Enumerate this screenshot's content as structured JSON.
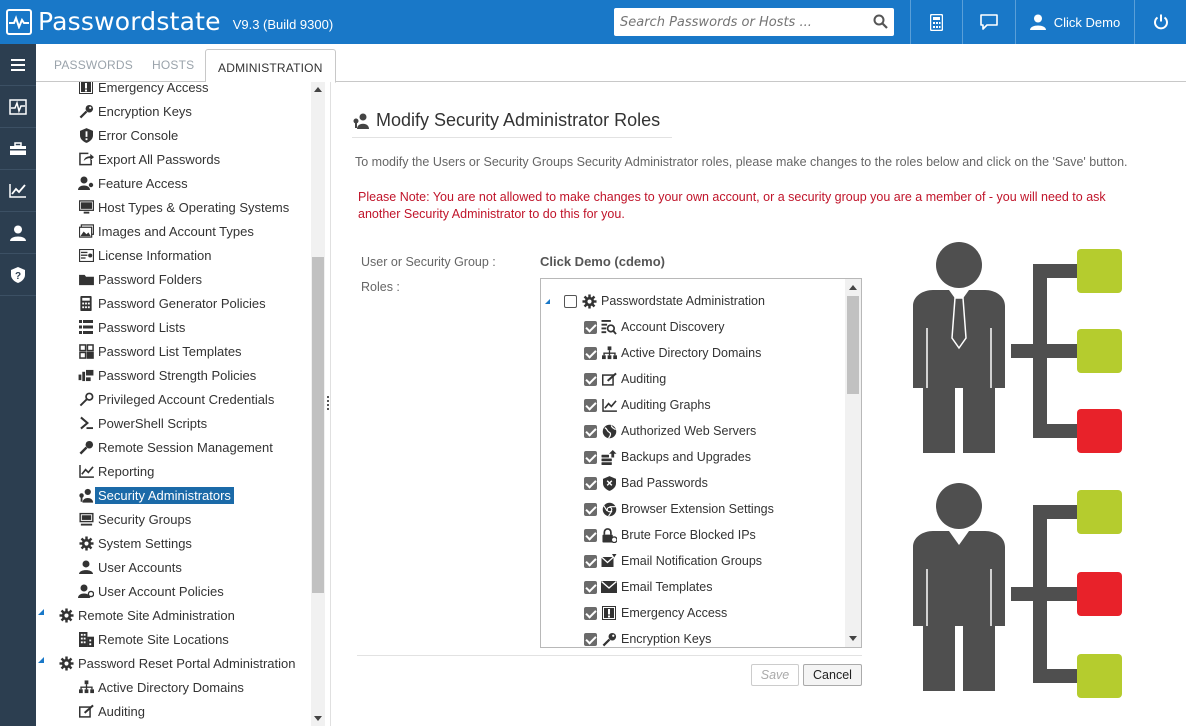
{
  "header": {
    "app_name": "Passwordstate",
    "version": "V9.3 (Build 9300)",
    "search_placeholder": "Search Passwords or Hosts ...",
    "user_name": "Click Demo",
    "bg_color": "#1978c8"
  },
  "rail_icons": [
    "menu-icon",
    "activity-icon",
    "toolbox-icon",
    "chart-icon",
    "user-admin-icon",
    "shield-icon"
  ],
  "tabs": [
    {
      "label": "PASSWORDS",
      "active": false
    },
    {
      "label": "HOSTS",
      "active": false
    },
    {
      "label": "ADMINISTRATION",
      "active": true
    }
  ],
  "tree": [
    {
      "label": "Emergency Access",
      "icon": "emergency-icon",
      "level": 2
    },
    {
      "label": "Encryption Keys",
      "icon": "key-icon",
      "level": 2
    },
    {
      "label": "Error Console",
      "icon": "shield-exclaim-icon",
      "level": 2
    },
    {
      "label": "Export All Passwords",
      "icon": "export-icon",
      "level": 2
    },
    {
      "label": "Feature Access",
      "icon": "user-key-icon",
      "level": 2
    },
    {
      "label": "Host Types & Operating Systems",
      "icon": "monitor-icon",
      "level": 2
    },
    {
      "label": "Images and Account Types",
      "icon": "images-icon",
      "level": 2
    },
    {
      "label": "License Information",
      "icon": "license-icon",
      "level": 2
    },
    {
      "label": "Password Folders",
      "icon": "folder-icon",
      "level": 2
    },
    {
      "label": "Password Generator Policies",
      "icon": "calculator-icon",
      "level": 2
    },
    {
      "label": "Password Lists",
      "icon": "list-icon",
      "level": 2
    },
    {
      "label": "Password List Templates",
      "icon": "templates-icon",
      "level": 2
    },
    {
      "label": "Password Strength Policies",
      "icon": "strength-icon",
      "level": 2
    },
    {
      "label": "Privileged Account Credentials",
      "icon": "privileged-key-icon",
      "level": 2
    },
    {
      "label": "PowerShell Scripts",
      "icon": "powershell-icon",
      "level": 2
    },
    {
      "label": "Remote Session Management",
      "icon": "remote-session-icon",
      "level": 2
    },
    {
      "label": "Reporting",
      "icon": "reporting-icon",
      "level": 2
    },
    {
      "label": "Security Administrators",
      "icon": "security-admins-icon",
      "level": 2,
      "selected": true
    },
    {
      "label": "Security Groups",
      "icon": "security-groups-icon",
      "level": 2
    },
    {
      "label": "System Settings",
      "icon": "gear-icon",
      "level": 2
    },
    {
      "label": "User Accounts",
      "icon": "user-icon",
      "level": 2
    },
    {
      "label": "User Account Policies",
      "icon": "user-policy-icon",
      "level": 2
    },
    {
      "label": "Remote Site Administration",
      "icon": "gear-icon",
      "level": 1,
      "expanded": true
    },
    {
      "label": "Remote Site Locations",
      "icon": "building-icon",
      "level": 2
    },
    {
      "label": "Password Reset Portal Administration",
      "icon": "gear-icon",
      "level": 1,
      "expanded": true
    },
    {
      "label": "Active Directory Domains",
      "icon": "sitemap-icon",
      "level": 2
    },
    {
      "label": "Auditing",
      "icon": "auditing-icon",
      "level": 2
    }
  ],
  "main": {
    "title": "Modify Security Administrator Roles",
    "description": "To modify the Users or Security Groups Security Administrator roles, please make changes to the roles below and click on the 'Save' button.",
    "note": "Please Note: You are not allowed to make changes to your own account, or a security group you are a member of - you will need to ask another Security Administrator to do this for you.",
    "user_group_label": "User or Security Group :",
    "user_group_value": "Click Demo (cdemo)",
    "roles_label": "Roles :",
    "roles_root": {
      "label": "Passwordstate Administration",
      "checked": false,
      "icon": "gear-icon"
    },
    "roles": [
      {
        "label": "Account Discovery",
        "icon": "account-discovery-icon",
        "checked": true
      },
      {
        "label": "Active Directory Domains",
        "icon": "sitemap-icon",
        "checked": true
      },
      {
        "label": "Auditing",
        "icon": "auditing-icon",
        "checked": true
      },
      {
        "label": "Auditing Graphs",
        "icon": "chart-line-icon",
        "checked": true
      },
      {
        "label": "Authorized Web Servers",
        "icon": "globe-icon",
        "checked": true
      },
      {
        "label": "Backups and Upgrades",
        "icon": "backup-icon",
        "checked": true
      },
      {
        "label": "Bad Passwords",
        "icon": "shield-x-icon",
        "checked": true
      },
      {
        "label": "Browser Extension Settings",
        "icon": "browser-icon",
        "checked": true
      },
      {
        "label": "Brute Force Blocked IPs",
        "icon": "lock-icon",
        "checked": true
      },
      {
        "label": "Email Notification Groups",
        "icon": "email-group-icon",
        "checked": true
      },
      {
        "label": "Email Templates",
        "icon": "envelope-icon",
        "checked": true
      },
      {
        "label": "Emergency Access",
        "icon": "emergency-icon",
        "checked": true
      },
      {
        "label": "Encryption Keys",
        "icon": "key-icon",
        "checked": true
      }
    ],
    "save_label": "Save",
    "cancel_label": "Cancel"
  },
  "colors": {
    "accent": "#1978c8",
    "rail": "#2c3e50",
    "note_red": "#c0142a",
    "selected_bg": "#1b6aa8",
    "illus_person": "#4f4f4f",
    "illus_green": "#b5cc2e",
    "illus_red": "#e8222a"
  }
}
